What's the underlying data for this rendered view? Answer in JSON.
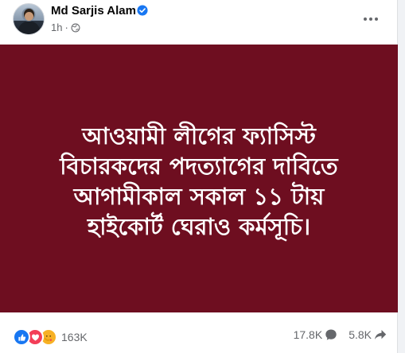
{
  "post": {
    "author": "Md Sarjis Alam",
    "time": "1h",
    "separator": "·",
    "privacy_icon": "globe-icon",
    "verified_icon": "verified-badge-icon",
    "more_icon": "more-options-icon"
  },
  "banner": {
    "background": "#6e0e20",
    "lines": [
      "আওয়ামী লীগের ফ্যাসিস্ট",
      "বিচারকদের পদত্যাগের দাবিতে",
      "আগামীকাল সকাল ১১ টায়",
      "হাইকোর্ট ঘেরাও কর্মসূচি।"
    ]
  },
  "footer": {
    "reactions": [
      "like",
      "love",
      "care"
    ],
    "reaction_count": "163K",
    "comments_count": "17.8K",
    "shares_count": "5.8K"
  },
  "colors": {
    "accent": "#1877f2",
    "text_secondary": "#65676b"
  }
}
